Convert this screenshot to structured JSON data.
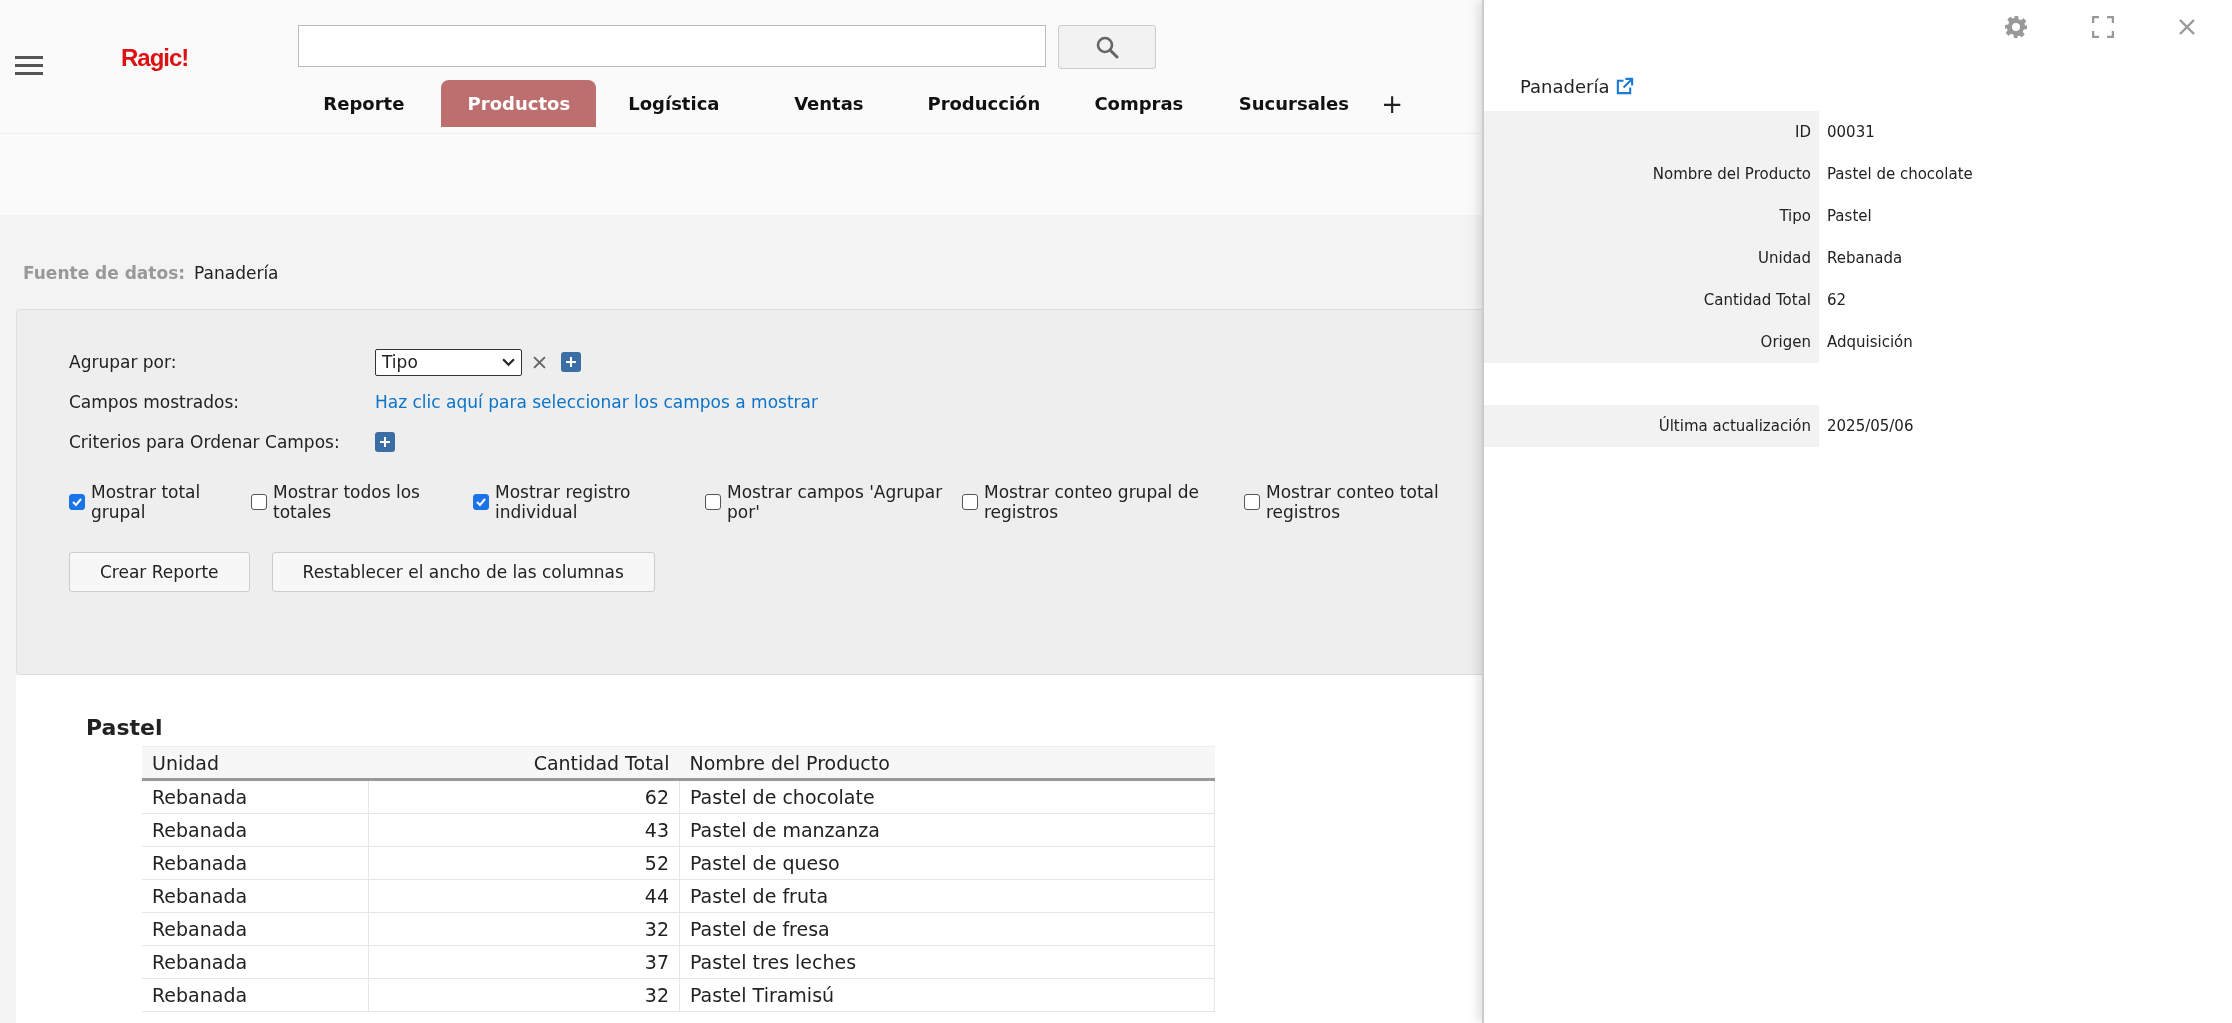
{
  "header": {
    "logo": "Ragic!"
  },
  "tabs": [
    {
      "label": "Reporte",
      "selected": false
    },
    {
      "label": "Productos",
      "selected": true
    },
    {
      "label": "Logística",
      "selected": false
    },
    {
      "label": "Ventas",
      "selected": false
    },
    {
      "label": "Producción",
      "selected": false
    },
    {
      "label": "Compras",
      "selected": false
    },
    {
      "label": "Sucursales",
      "selected": false
    }
  ],
  "add_tab": "+",
  "data_source": {
    "label": "Fuente de datos:",
    "value": "Panadería"
  },
  "options": {
    "group_by": {
      "label": "Agrupar por:",
      "value": "Tipo"
    },
    "fields_shown": {
      "label": "Campos mostrados:",
      "link": "Haz clic aquí para seleccionar los campos a mostrar"
    },
    "sort": {
      "label": "Criterios para Ordenar Campos:"
    },
    "checkboxes": [
      {
        "label": "Mostrar total grupal",
        "checked": true
      },
      {
        "label": "Mostrar todos los totales",
        "checked": false
      },
      {
        "label": "Mostrar registro individual",
        "checked": true
      },
      {
        "label": "Mostrar campos 'Agrupar por'",
        "checked": false
      },
      {
        "label": "Mostrar conteo grupal de registros",
        "checked": false
      },
      {
        "label": "Mostrar conteo total registros",
        "checked": false
      }
    ],
    "buttons": [
      "Crear Reporte",
      "Restablecer el ancho de las columnas"
    ]
  },
  "report": {
    "group_title": "Pastel",
    "columns": [
      "Unidad",
      "Cantidad Total",
      "Nombre del Producto"
    ],
    "rows": [
      [
        "Rebanada",
        "62",
        "Pastel de chocolate"
      ],
      [
        "Rebanada",
        "43",
        "Pastel de manzanza"
      ],
      [
        "Rebanada",
        "52",
        "Pastel de queso"
      ],
      [
        "Rebanada",
        "44",
        "Pastel de fruta"
      ],
      [
        "Rebanada",
        "32",
        "Pastel de fresa"
      ],
      [
        "Rebanada",
        "37",
        "Pastel tres leches"
      ],
      [
        "Rebanada",
        "32",
        "Pastel Tiramisú"
      ]
    ]
  },
  "record_panel": {
    "title": "Panadería",
    "fields": [
      {
        "label": "ID",
        "value": "00031"
      },
      {
        "label": "Nombre del Producto",
        "value": "Pastel de chocolate"
      },
      {
        "label": "Tipo",
        "value": "Pastel"
      },
      {
        "label": "Unidad",
        "value": "Rebanada"
      },
      {
        "label": "Cantidad Total",
        "value": "62"
      },
      {
        "label": "Origen",
        "value": "Adquisición"
      }
    ],
    "footer_fields": [
      {
        "label": "Última actualización",
        "value": "2025/05/06"
      }
    ]
  }
}
